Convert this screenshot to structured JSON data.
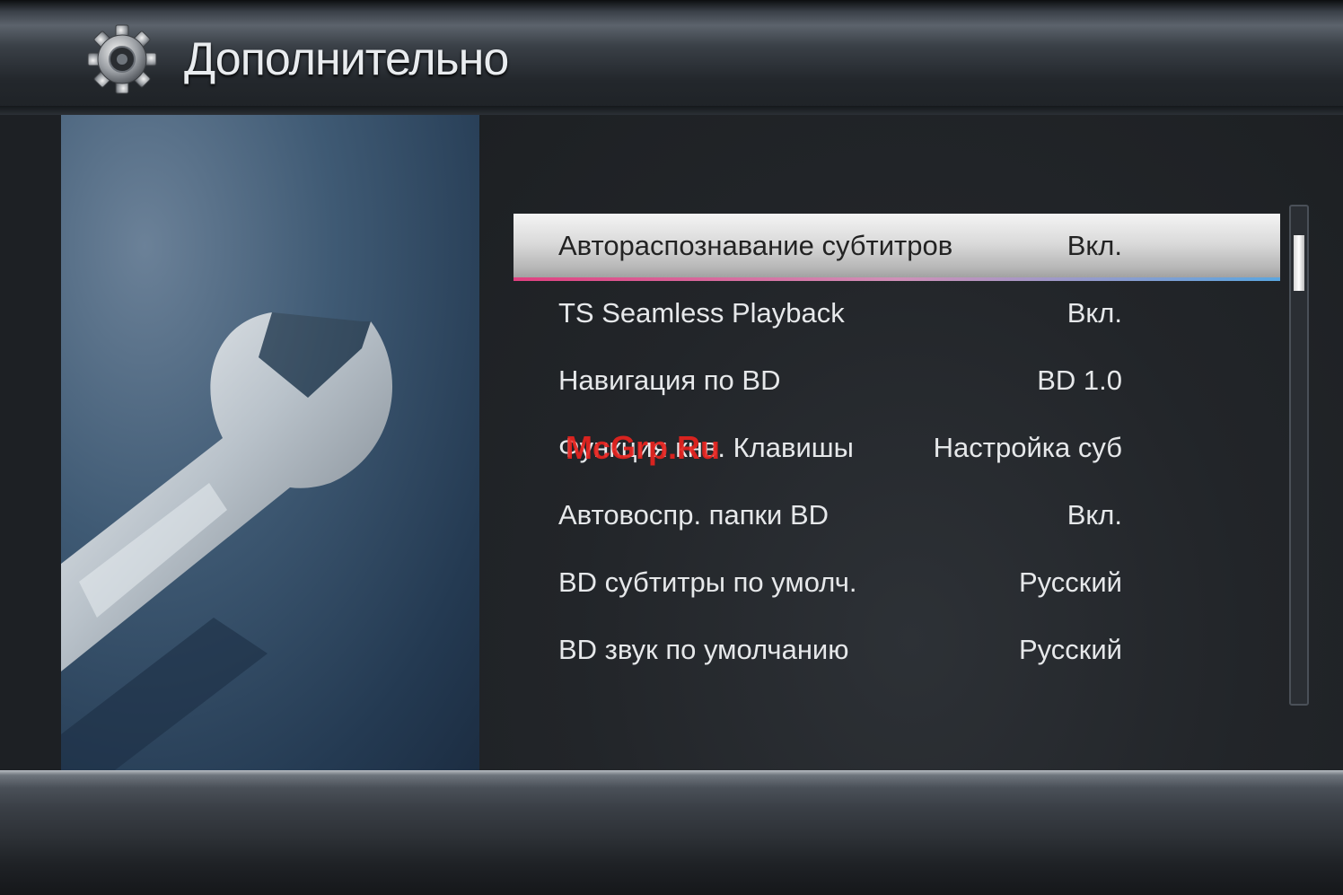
{
  "header": {
    "title": "Дополнительно",
    "icon": "gear-icon"
  },
  "menu": {
    "items": [
      {
        "label": "Автораспознавание субтитров",
        "value": "Вкл."
      },
      {
        "label": "TS Seamless Playback",
        "value": "Вкл."
      },
      {
        "label": "Навигация по BD",
        "value": "BD 1.0"
      },
      {
        "label": "Функция кнв. Клавишы",
        "value": "Настройка суб"
      },
      {
        "label": "Автовоспр. папки BD",
        "value": "Вкл."
      },
      {
        "label": "BD субтитры по умолч.",
        "value": "Русский"
      },
      {
        "label": "BD звук по умолчанию",
        "value": "Русский"
      }
    ],
    "selected_index": 0
  },
  "watermark": "McGrp.Ru",
  "colors": {
    "highlight_start": "#e04080",
    "highlight_end": "#5aa6e0",
    "watermark": "#e8231f"
  }
}
